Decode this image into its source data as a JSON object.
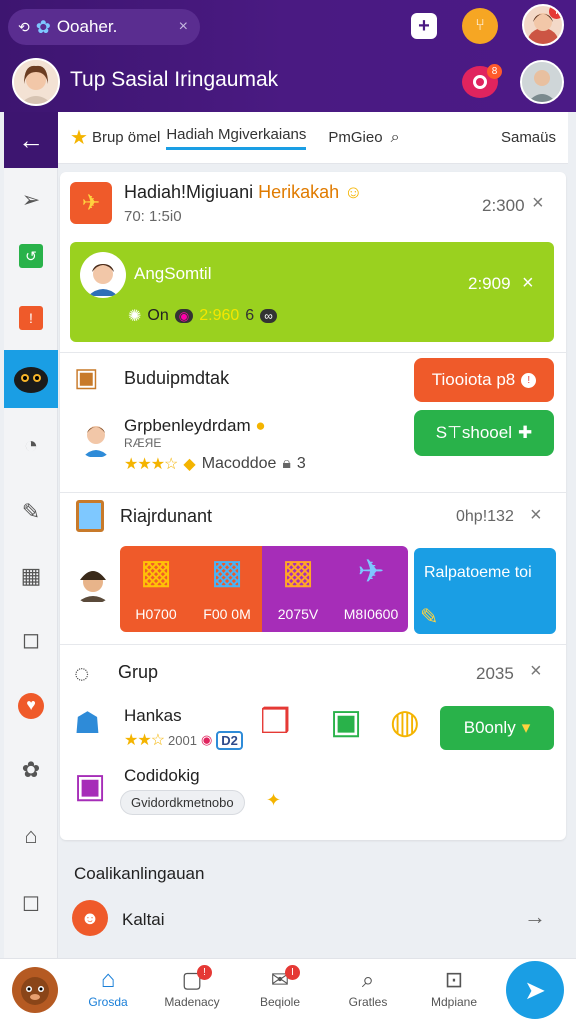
{
  "topbar": {
    "tab_label": "Ooaher.",
    "tab_close": "×",
    "title": "Tup Sasial Iringaumak"
  },
  "subtabs": {
    "tab1": "Brup ömel",
    "tab2": "Hadiah Mgiverkaians",
    "tab3": "PmGieo",
    "tab4": "Samaüs"
  },
  "card1": {
    "title_a": "Hadiah!Migiuani",
    "title_b": "Herikakah",
    "subtitle": "70: 1:5i0",
    "value": "2:300",
    "close": "×"
  },
  "green_banner": {
    "name": "AngSomtil",
    "value": "2:909",
    "close": "×",
    "meta_on": "On",
    "meta_num": "2:960",
    "meta_suffix": "6"
  },
  "section2": {
    "title": "Buduipmdtak",
    "button_orange": "Tiooiota p8",
    "item_title": "Grpbenleydrdam",
    "item_label": "Macoddoe",
    "item_count": "3",
    "button_green": "S⊤shooel",
    "stars": "★★★☆"
  },
  "section3": {
    "title": "Riajrdunant",
    "value": "0hp!132",
    "close": "×"
  },
  "promo_tiles": [
    {
      "label": "H0700"
    },
    {
      "label": "F00 0M"
    },
    {
      "label": "2075V"
    },
    {
      "label": "M8I0600"
    }
  ],
  "promo_blue": {
    "label": "Ralpatoeme toi"
  },
  "group": {
    "title": "Grup",
    "value": "2035",
    "close": "×",
    "item1_title": "Hankas",
    "item1_meta": "2001",
    "item1_badge": "D2",
    "button": "B0only",
    "item2_title": "Codidokig",
    "item2_chip": "Gvidordkmetnobo"
  },
  "footer_section": {
    "title": "Coalikanlingauan",
    "item": "Kaltai",
    "arrow": "→"
  },
  "bottom_nav": [
    {
      "label": "Grosda"
    },
    {
      "label": "Madenacy"
    },
    {
      "label": "Beqiole"
    },
    {
      "label": "Gratles"
    },
    {
      "label": "Mdpiane"
    }
  ],
  "colors": {
    "header": "#4a1a82",
    "accent_green": "#29b24a",
    "accent_orange": "#ef5a2a",
    "accent_blue": "#1a9ee4",
    "lime": "#9ad11f"
  }
}
